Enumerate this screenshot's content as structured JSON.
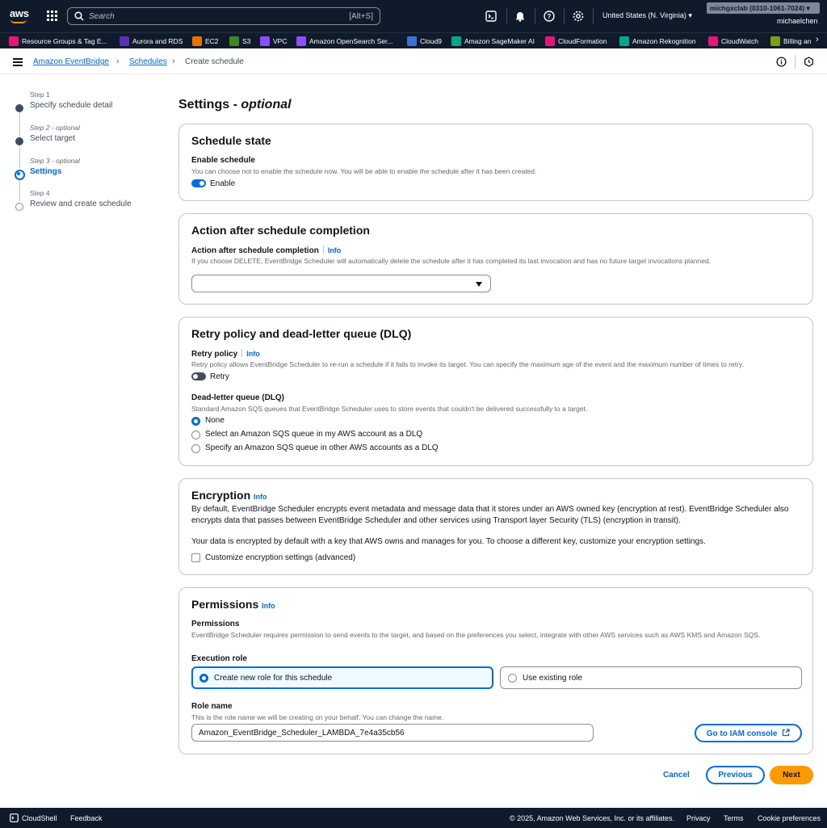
{
  "topnav": {
    "logo_text": "aws",
    "search_placeholder": "Search",
    "search_shortcut": "[Alt+S]",
    "region": "United States (N. Virginia)",
    "account": "michgxclab (0310-1061-7024)",
    "username": "michaelchen",
    "icons": [
      "cloudshell-icon",
      "bell-icon",
      "help-icon",
      "gear-icon"
    ]
  },
  "favorites": [
    {
      "label": "Resource Groups & Tag E...",
      "color": "#e7157b"
    },
    {
      "label": "Aurora and RDS",
      "color": "#5a30b5"
    },
    {
      "label": "EC2",
      "color": "#ed7100"
    },
    {
      "label": "S3",
      "color": "#3f8624"
    },
    {
      "label": "VPC",
      "color": "#8c4fff"
    },
    {
      "label": "Amazon OpenSearch Ser...",
      "color": "#8c4fff"
    },
    {
      "label": "Cloud9",
      "color": "#3f6fd8"
    },
    {
      "label": "Amazon SageMaker AI",
      "color": "#01a88d"
    },
    {
      "label": "CloudFormation",
      "color": "#e7157b"
    },
    {
      "label": "Amazon Rekognition",
      "color": "#01a88d"
    },
    {
      "label": "CloudWatch",
      "color": "#e7157b"
    },
    {
      "label": "Billing an",
      "color": "#7aa116"
    }
  ],
  "breadcrumb": {
    "items": [
      "Amazon EventBridge",
      "Schedules",
      "Create schedule"
    ]
  },
  "steps": [
    {
      "num": "Step 1",
      "label": "Specify schedule detail"
    },
    {
      "num": "Step 2 - optional",
      "label": "Select target"
    },
    {
      "num": "Step 3 - optional",
      "label": "Settings"
    },
    {
      "num": "Step 4",
      "label": "Review and create schedule"
    }
  ],
  "page": {
    "title": "Settings - ",
    "title_em": "optional"
  },
  "schedule_state": {
    "title": "Schedule state",
    "label": "Enable schedule",
    "desc": "You can choose not to enable the schedule now. You will be able to enable the schedule after it has been created.",
    "toggle_label": "Enable",
    "enabled": true
  },
  "action": {
    "title": "Action after schedule completion",
    "label": "Action after schedule completion",
    "info": "Info",
    "desc": "If you choose DELETE, EventBridge Scheduler will automatically delete the schedule after it has completed its last invocation and has no future target invocations planned.",
    "value": ""
  },
  "retry": {
    "title": "Retry policy and dead-letter queue (DLQ)",
    "label": "Retry policy",
    "info": "Info",
    "desc": "Retry policy allows EventBridge Scheduler to re-run a schedule if it fails to invoke its target. You can specify the maximum age of the event and the maximum number of times to retry.",
    "toggle_label": "Retry",
    "enabled": false,
    "dlq_label": "Dead-letter queue (DLQ)",
    "dlq_desc": "Standard Amazon SQS queues that EventBridge Scheduler uses to store events that couldn't be delivered successfully to a target.",
    "dlq_options": [
      "None",
      "Select an Amazon SQS queue in my AWS account as a DLQ",
      "Specify an Amazon SQS queue in other AWS accounts as a DLQ"
    ],
    "dlq_selected": "None"
  },
  "encryption": {
    "title": "Encryption",
    "info": "Info",
    "desc1": "By default, EventBridge Scheduler encrypts event metadata and message data that it stores under an AWS owned key (encryption at rest). EventBridge Scheduler also encrypts data that passes between EventBridge Scheduler and other services using Transport layer Security (TLS) (encryption in transit).",
    "desc2": "Your data is encrypted by default with a key that AWS owns and manages for you. To choose a different key, customize your encryption settings.",
    "checkbox_label": "Customize encryption settings (advanced)"
  },
  "permissions": {
    "title": "Permissions",
    "info": "Info",
    "label": "Permissions",
    "desc": "EventBridge Scheduler requires permission to send events to the target, and based on the preferences you select, integrate with other AWS services such as AWS KMS and Amazon SQS.",
    "exec_label": "Execution role",
    "opt_new": "Create new role for this schedule",
    "opt_existing": "Use existing role",
    "role_label": "Role name",
    "role_desc": "This is the role name we will be creating on your behalf. You can change the name.",
    "role_value": "Amazon_EventBridge_Scheduler_LAMBDA_7e4a35cb56",
    "iam_button": "Go to IAM console"
  },
  "actions": {
    "cancel": "Cancel",
    "previous": "Previous",
    "next": "Next"
  },
  "footer": {
    "cloudshell": "CloudShell",
    "feedback": "Feedback",
    "copyright": "© 2025, Amazon Web Services, Inc. or its affiliates.",
    "privacy": "Privacy",
    "terms": "Terms",
    "cookies": "Cookie preferences"
  }
}
